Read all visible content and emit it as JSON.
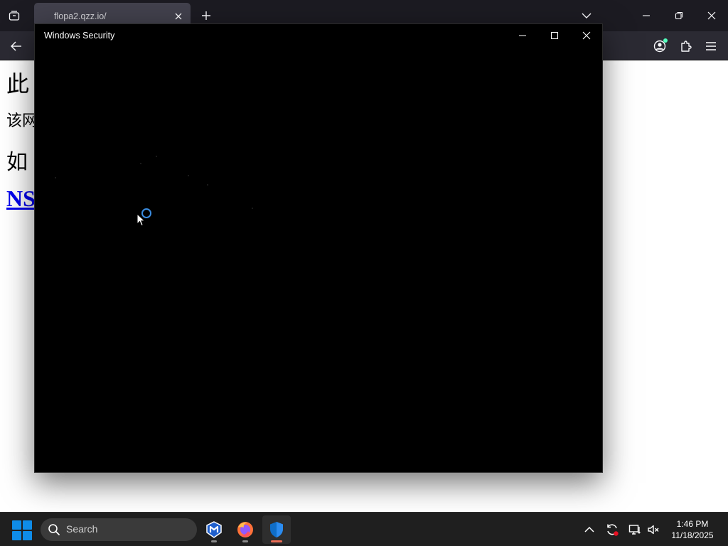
{
  "browser": {
    "tab": {
      "title": "flopa2.qzz.io/"
    },
    "icons": {
      "tab_view": "tab-view-icon",
      "tab_close": "close-icon",
      "new_tab": "plus-icon",
      "tab_list": "chevron-down-icon",
      "back": "arrow-left-icon",
      "account": "account-icon",
      "extensions": "puzzle-icon",
      "menu": "hamburger-icon"
    }
  },
  "page": {
    "heading": "此",
    "paragraph": "该网",
    "heading2": "如",
    "link": "NS",
    "link_color": "#0000ee"
  },
  "security_window": {
    "title": "Windows Security",
    "background": "#000000",
    "loading": true,
    "spinner_color": "#3a8ce0"
  },
  "taskbar": {
    "search_placeholder": "Search",
    "apps": [
      {
        "name": "Malwarebytes",
        "icon": "malwarebytes-icon",
        "running": true
      },
      {
        "name": "Firefox",
        "icon": "firefox-icon",
        "running": true
      },
      {
        "name": "Windows Security",
        "icon": "shield-icon",
        "running": true,
        "active": true
      }
    ],
    "clock": {
      "time": "1:46 PM",
      "date": "11/18/2025"
    },
    "accent": "#0f8ce8"
  }
}
